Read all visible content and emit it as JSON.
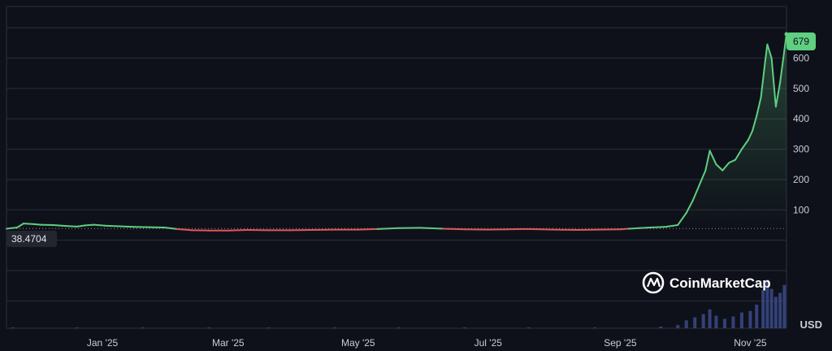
{
  "chart_data": {
    "type": "line",
    "unit": "USD",
    "brand": "CoinMarketCap",
    "baseline_label": "38.4704",
    "baseline_value": 38.4704,
    "last_price_label": "679",
    "last_price_value": 679,
    "y_ticks": [
      "100",
      "200",
      "300",
      "400",
      "500",
      "600"
    ],
    "y_tick_values": [
      100,
      200,
      300,
      400,
      500,
      600
    ],
    "ylim": [
      -290,
      770
    ],
    "x_ticks": [
      "Jan '25",
      "Mar '25",
      "May '25",
      "Jul '25",
      "Sep '25",
      "Nov '25"
    ],
    "x_tick_dates": [
      "2025-01-01",
      "2025-03-01",
      "2025-05-01",
      "2025-07-01",
      "2025-09-01",
      "2025-11-01"
    ],
    "x_range": [
      "2024-11-17",
      "2025-11-18"
    ],
    "grid": true,
    "colors": {
      "up": "#5fcf80",
      "down": "#e45656",
      "volume": "#3b4a8a",
      "grid": "#2a2e39"
    },
    "series": [
      {
        "points": [
          [
            "2024-11-17",
            38
          ],
          [
            "2024-11-22",
            42
          ],
          [
            "2024-11-25",
            55
          ],
          [
            "2024-11-30",
            53
          ],
          [
            "2024-12-03",
            51
          ],
          [
            "2024-12-09",
            50
          ],
          [
            "2024-12-15",
            47
          ],
          [
            "2024-12-20",
            45
          ],
          [
            "2024-12-24",
            49
          ],
          [
            "2024-12-28",
            51
          ],
          [
            "2025-01-02",
            48
          ],
          [
            "2025-01-09",
            46
          ],
          [
            "2025-01-16",
            44
          ],
          [
            "2025-01-23",
            43
          ],
          [
            "2025-01-30",
            42
          ],
          [
            "2025-02-05",
            37
          ],
          [
            "2025-02-12",
            33
          ],
          [
            "2025-02-20",
            32
          ],
          [
            "2025-03-01",
            32
          ],
          [
            "2025-03-10",
            34
          ],
          [
            "2025-03-20",
            33
          ],
          [
            "2025-03-30",
            33
          ],
          [
            "2025-04-10",
            34
          ],
          [
            "2025-04-20",
            35
          ],
          [
            "2025-05-01",
            35
          ],
          [
            "2025-05-10",
            37
          ],
          [
            "2025-05-20",
            40
          ],
          [
            "2025-05-30",
            41
          ],
          [
            "2025-06-10",
            38
          ],
          [
            "2025-06-20",
            36
          ],
          [
            "2025-07-01",
            35
          ],
          [
            "2025-07-10",
            36
          ],
          [
            "2025-07-20",
            37
          ],
          [
            "2025-08-01",
            35
          ],
          [
            "2025-08-12",
            34
          ],
          [
            "2025-08-22",
            35
          ],
          [
            "2025-09-01",
            36
          ],
          [
            "2025-09-05",
            38
          ],
          [
            "2025-09-10",
            40
          ],
          [
            "2025-09-15",
            42
          ],
          [
            "2025-09-22",
            44
          ],
          [
            "2025-09-28",
            50
          ],
          [
            "2025-10-02",
            90
          ],
          [
            "2025-10-05",
            130
          ],
          [
            "2025-10-08",
            180
          ],
          [
            "2025-10-11",
            230
          ],
          [
            "2025-10-13",
            295
          ],
          [
            "2025-10-16",
            250
          ],
          [
            "2025-10-19",
            230
          ],
          [
            "2025-10-22",
            255
          ],
          [
            "2025-10-25",
            265
          ],
          [
            "2025-10-28",
            300
          ],
          [
            "2025-10-31",
            330
          ],
          [
            "2025-11-02",
            360
          ],
          [
            "2025-11-04",
            410
          ],
          [
            "2025-11-06",
            470
          ],
          [
            "2025-11-08",
            590
          ],
          [
            "2025-11-09",
            645
          ],
          [
            "2025-11-11",
            600
          ],
          [
            "2025-11-13",
            440
          ],
          [
            "2025-11-15",
            520
          ],
          [
            "2025-11-18",
            679
          ]
        ]
      }
    ],
    "volume": [
      [
        "2024-11-20",
        1
      ],
      [
        "2024-12-20",
        1
      ],
      [
        "2025-01-20",
        1
      ],
      [
        "2025-02-20",
        1
      ],
      [
        "2025-03-20",
        1
      ],
      [
        "2025-04-20",
        1
      ],
      [
        "2025-05-20",
        1
      ],
      [
        "2025-06-20",
        1
      ],
      [
        "2025-07-20",
        1
      ],
      [
        "2025-08-20",
        1
      ],
      [
        "2025-09-20",
        2
      ],
      [
        "2025-09-28",
        4
      ],
      [
        "2025-10-02",
        10
      ],
      [
        "2025-10-06",
        14
      ],
      [
        "2025-10-10",
        18
      ],
      [
        "2025-10-13",
        24
      ],
      [
        "2025-10-16",
        16
      ],
      [
        "2025-10-20",
        12
      ],
      [
        "2025-10-24",
        15
      ],
      [
        "2025-10-28",
        20
      ],
      [
        "2025-11-01",
        22
      ],
      [
        "2025-11-04",
        30
      ],
      [
        "2025-11-07",
        48
      ],
      [
        "2025-11-09",
        62
      ],
      [
        "2025-11-11",
        50
      ],
      [
        "2025-11-13",
        40
      ],
      [
        "2025-11-15",
        45
      ],
      [
        "2025-11-17",
        55
      ]
    ]
  }
}
